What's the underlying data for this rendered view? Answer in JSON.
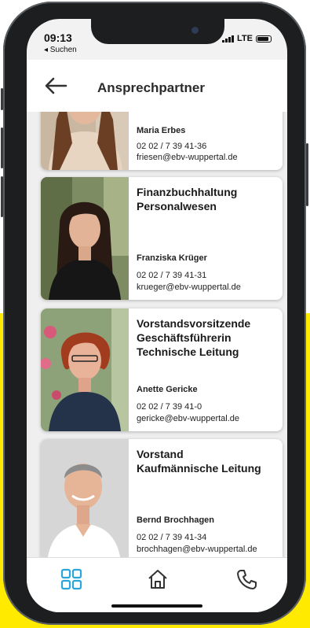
{
  "status": {
    "time": "09:13",
    "back_app": "◂ Suchen",
    "network": "LTE"
  },
  "header": {
    "title": "Ansprechpartner"
  },
  "contacts": [
    {
      "role_line1": "",
      "role_line2": "",
      "role_line3": "",
      "name": "Maria Erbes",
      "phone": "02 02 / 7 39 41-36",
      "email": "friesen@ebv-wuppertal.de"
    },
    {
      "role_line1": "Finanzbuchhaltung",
      "role_line2": "Personalwesen",
      "role_line3": "",
      "name": "Franziska Krüger",
      "phone": "02 02 / 7 39 41-31",
      "email": "krueger@ebv-wuppertal.de"
    },
    {
      "role_line1": "Vorstandsvorsitzende",
      "role_line2": "Geschäftsführerin",
      "role_line3": "Technische Leitung",
      "name": "Anette Gericke",
      "phone": "02 02 / 7 39 41-0",
      "email": "gericke@ebv-wuppertal.de"
    },
    {
      "role_line1": "Vorstand",
      "role_line2": "Kaufmännische Leitung",
      "role_line3": "",
      "name": "Bernd Brochhagen",
      "phone": "02 02 / 7 39 41-34",
      "email": "brochhagen@ebv-wuppertal.de"
    }
  ],
  "tabs": {
    "accent": "#2aa7d8",
    "icon_color": "#333333"
  }
}
